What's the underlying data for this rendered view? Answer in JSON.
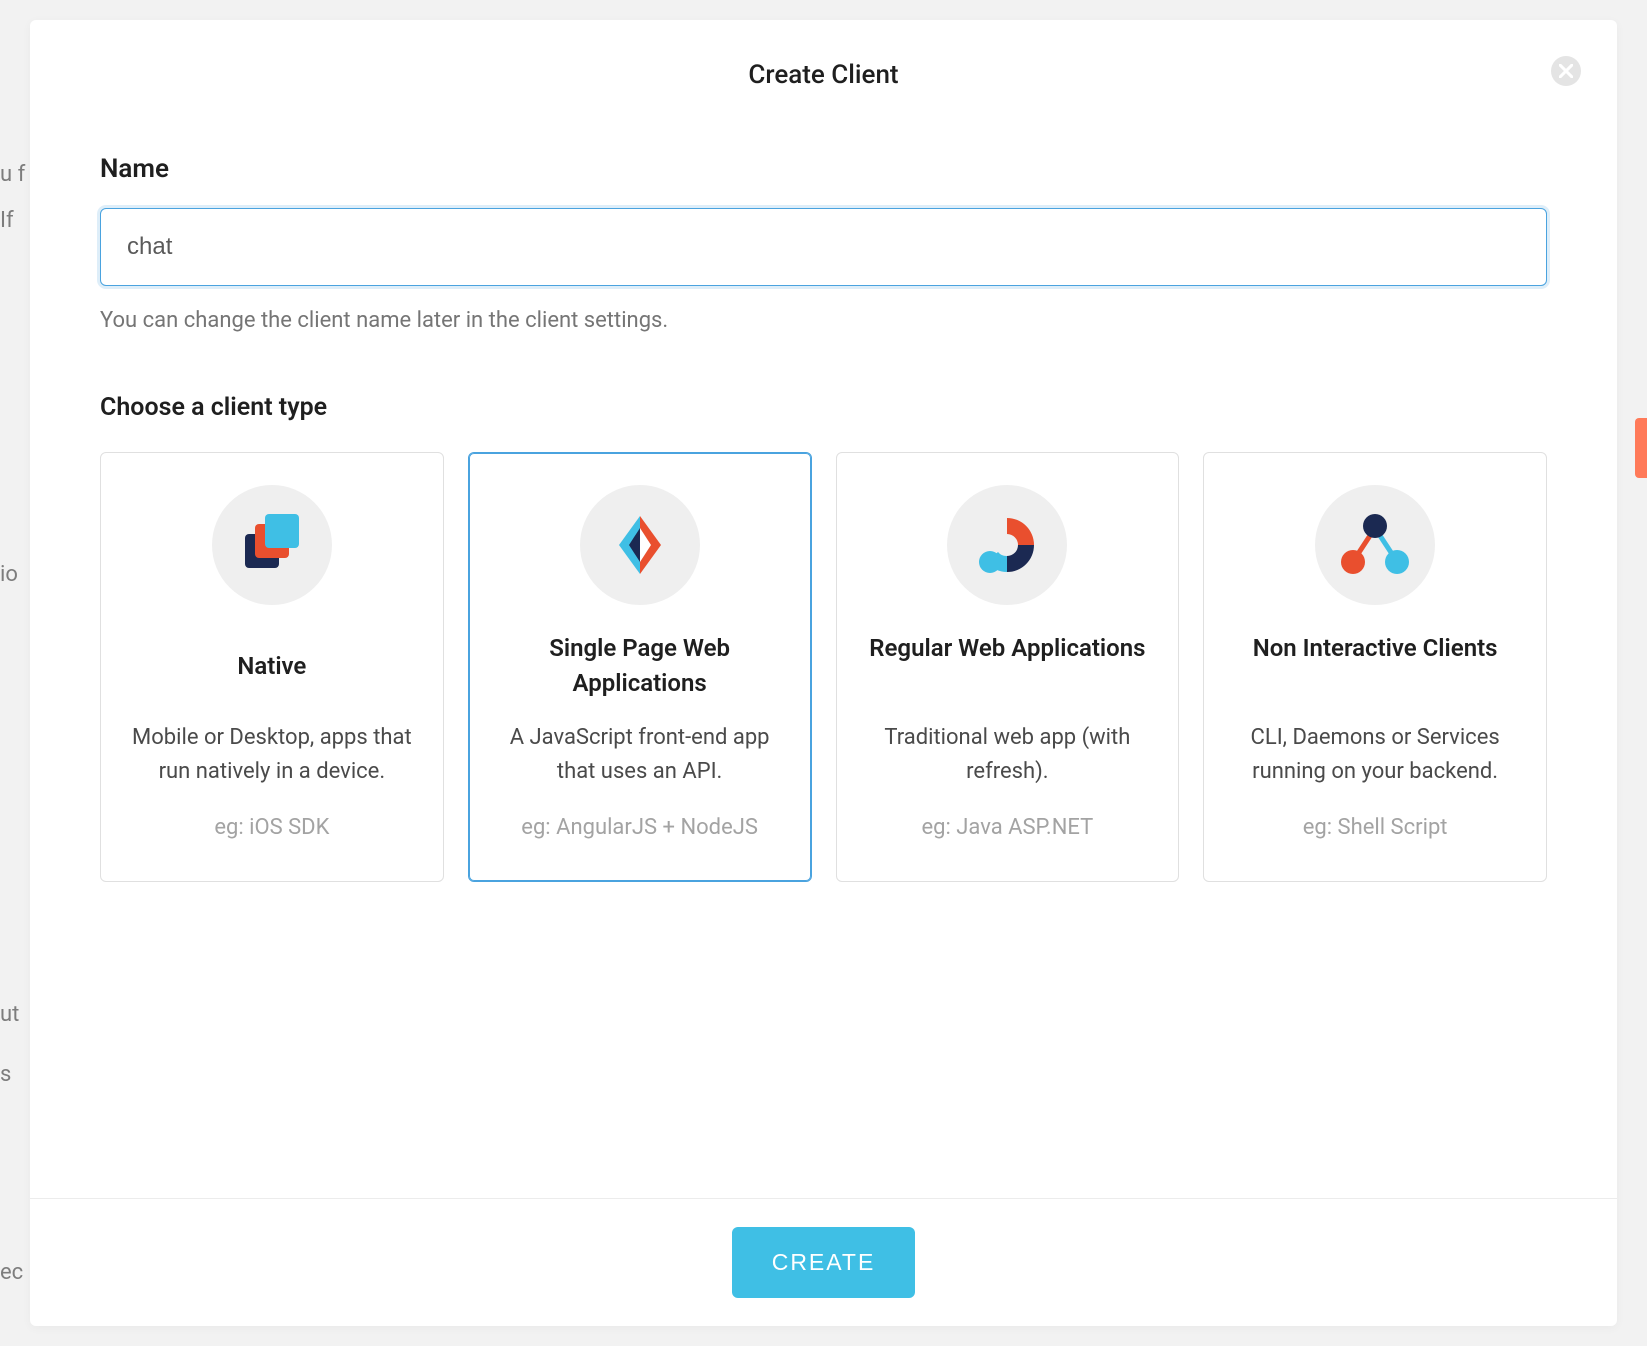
{
  "modal": {
    "title": "Create Client",
    "name_label": "Name",
    "name_value": "chat",
    "name_hint": "You can change the client name later in the client settings.",
    "type_label": "Choose a client type",
    "create_button": "CREATE",
    "close_icon": "close-icon",
    "selected_index": 1,
    "types": [
      {
        "icon": "native-icon",
        "title": "Native",
        "description": "Mobile or Desktop, apps that run natively in a device.",
        "example": "eg: iOS SDK"
      },
      {
        "icon": "spa-icon",
        "title": "Single Page Web Applications",
        "description": "A JavaScript front-end app that uses an API.",
        "example": "eg: AngularJS + NodeJS"
      },
      {
        "icon": "webapp-icon",
        "title": "Regular Web Applications",
        "description": "Traditional web app (with refresh).",
        "example": "eg: Java ASP.NET"
      },
      {
        "icon": "noninteractive-icon",
        "title": "Non Interactive Clients",
        "description": "CLI, Daemons or Services running on your backend.",
        "example": "eg: Shell Script"
      }
    ]
  },
  "colors": {
    "accent_blue": "#3fbfe5",
    "light_blue": "#3fbfe5",
    "orange": "#e94f2e",
    "navy": "#1b2952"
  }
}
